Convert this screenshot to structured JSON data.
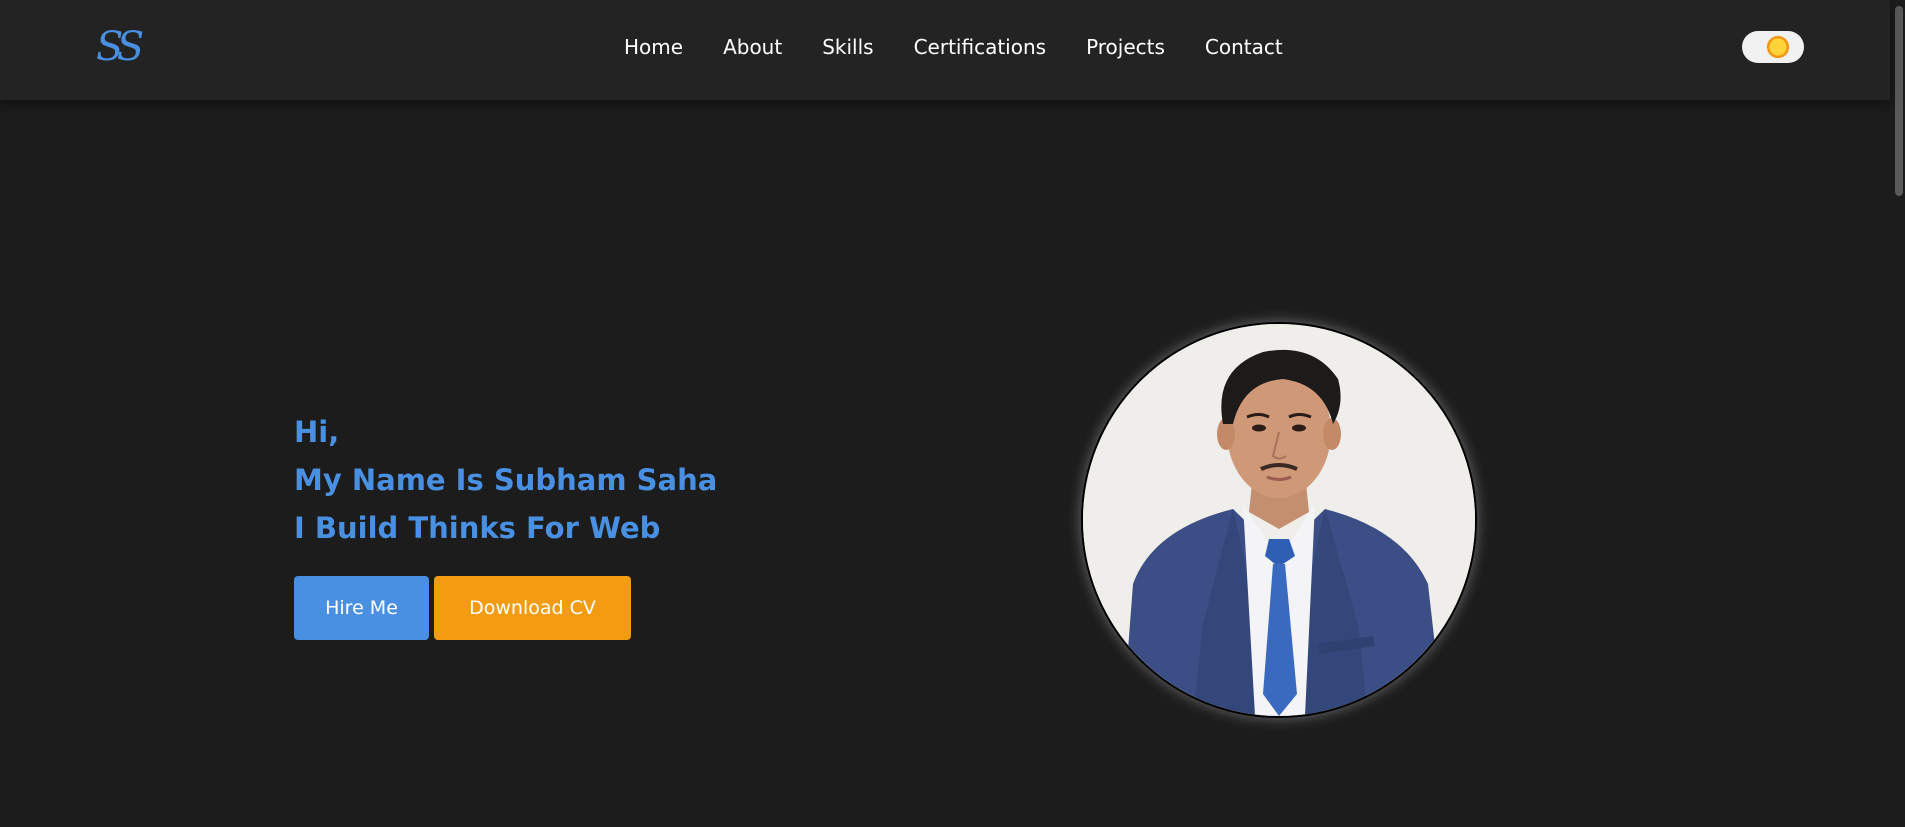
{
  "logo": {
    "text": "SS",
    "color": "#4a90e2"
  },
  "nav": {
    "items": [
      {
        "label": "Home"
      },
      {
        "label": "About"
      },
      {
        "label": "Skills"
      },
      {
        "label": "Certifications"
      },
      {
        "label": "Projects"
      },
      {
        "label": "Contact"
      }
    ]
  },
  "theme_toggle": {
    "icon": "sun-icon",
    "mode": "dark"
  },
  "hero": {
    "greeting": "Hi,",
    "name_line": "My Name Is Subham Saha",
    "tagline": "I Build Thinks For Web",
    "text_color": "#4a90e2",
    "buttons": {
      "hire_label": "Hire Me",
      "cv_label": "Download CV",
      "hire_color": "#4a90e2",
      "cv_color": "#f39c12"
    }
  },
  "profile_image": {
    "alt": "profile photo"
  },
  "colors": {
    "background": "#1c1c1c",
    "navbar": "#232323"
  }
}
